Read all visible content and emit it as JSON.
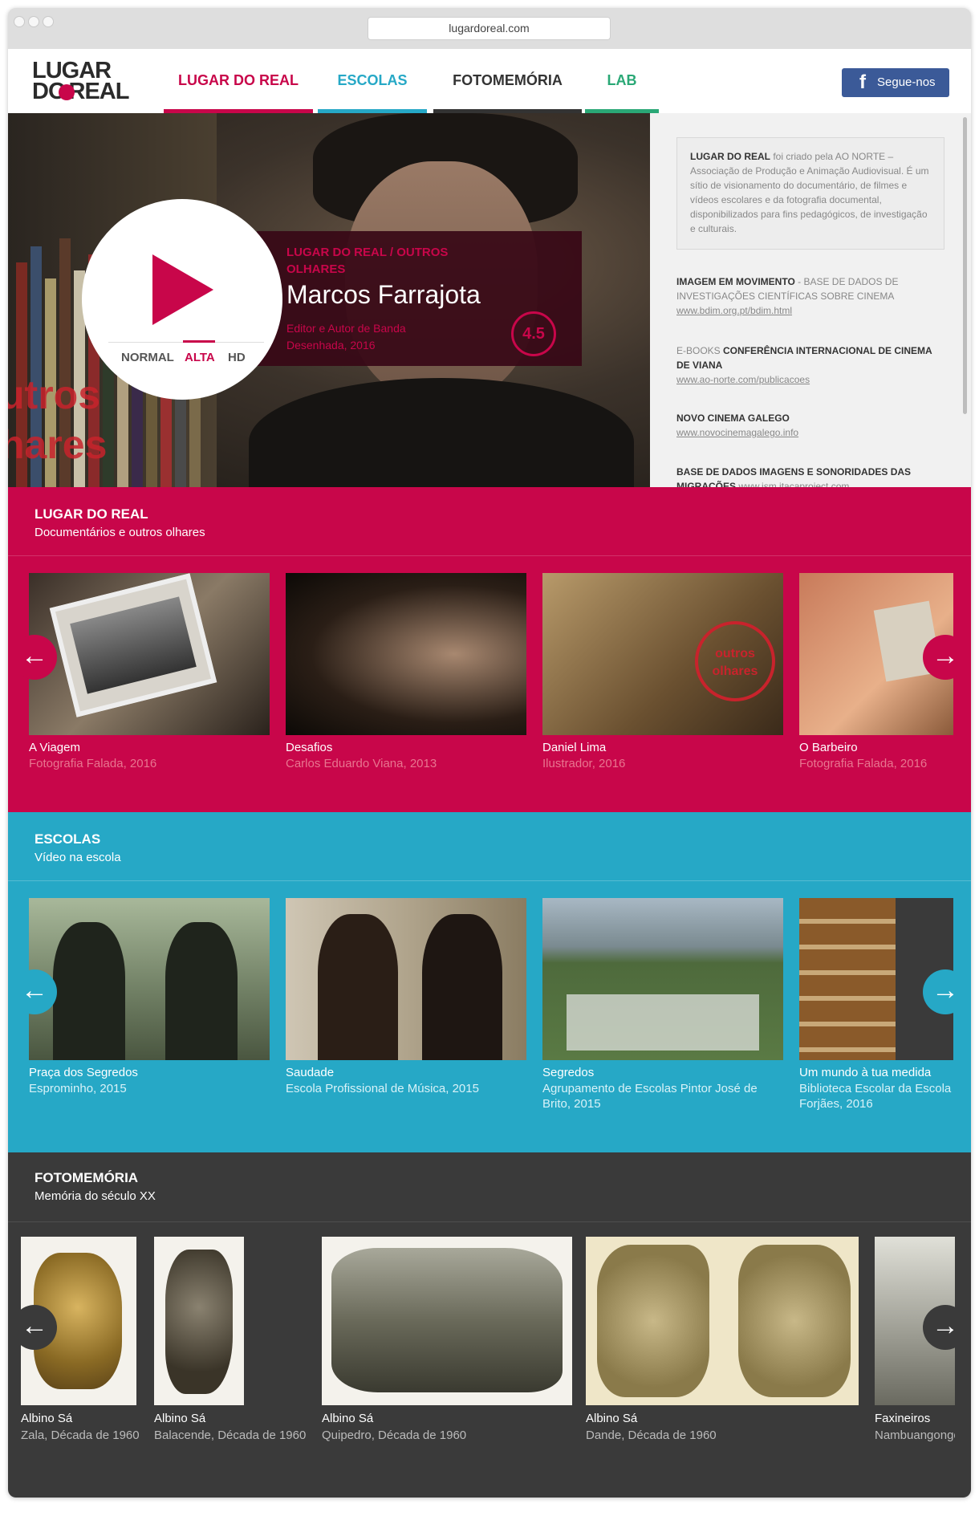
{
  "browser": {
    "url": "lugardoreal.com"
  },
  "logo": {
    "line1": "LUGAR",
    "line2_a": "DO",
    "line2_b": "REAL"
  },
  "nav": [
    {
      "label": "LUGAR DO REAL",
      "color": "#c8064a"
    },
    {
      "label": "ESCOLAS",
      "color": "#26a8c6"
    },
    {
      "label": "FOTOMEMÓRIA",
      "color": "#333333"
    },
    {
      "label": "LAB",
      "color": "#2aa876"
    }
  ],
  "social": {
    "icon": "facebook-icon",
    "label": "Segue-nos"
  },
  "hero": {
    "category": "LUGAR DO REAL / OUTROS OLHARES",
    "title": "Marcos Farrajota",
    "role": "Editor e Autor de Banda Desenhada, 2016",
    "rating": "4.5",
    "quality": [
      "NORMAL",
      "ALTA",
      "HD"
    ],
    "quality_selected": "ALTA",
    "stamp": "outros olhares"
  },
  "aside": {
    "intro_bold": "LUGAR DO REAL",
    "intro_text": " foi criado pela AO NORTE – Associação de Produção e Animação Audiovisual. É um sítio de visionamento do documentário, de filmes e vídeos escolares e da fotografia documental, disponibilizados para fins pedagógicos, de investigação e culturais.",
    "links": [
      {
        "bold": "IMAGEM EM MOVIMENTO",
        "text": " - BASE DE DADOS DE INVESTIGAÇÕES CIENTÍFICAS SOBRE CINEMA",
        "url": "www.bdim.org.pt/bdim.html"
      },
      {
        "pre": "E-BOOKS ",
        "bold": "CONFERÊNCIA INTERNACIONAL DE CINEMA DE VIANA",
        "text": "",
        "url": "www.ao-norte.com/publicacoes"
      },
      {
        "bold": "NOVO CINEMA GALEGO",
        "text": "",
        "url": "www.novocinemagalego.info"
      },
      {
        "bold": "BASE DE DADOS IMAGENS E SONORIDADES DAS MIGRAÇÕES",
        "text": "",
        "url": "www.ism.itacaproject.com"
      }
    ]
  },
  "sections": {
    "lugar": {
      "title": "LUGAR DO REAL",
      "subtitle": "Documentários e outros olhares",
      "color": "#c8064a",
      "items": [
        {
          "title": "A Viagem",
          "sub": "Fotografia Falada, 2016"
        },
        {
          "title": "Desafios",
          "sub": "Carlos Eduardo Viana, 2013"
        },
        {
          "title": "Daniel Lima",
          "sub": "Ilustrador, 2016"
        },
        {
          "title": "O Barbeiro",
          "sub": "Fotografia Falada, 2016"
        }
      ]
    },
    "escolas": {
      "title": "ESCOLAS",
      "subtitle": "Vídeo na escola",
      "color": "#26a8c6",
      "items": [
        {
          "title": "Praça dos Segredos",
          "sub": "Esprominho, 2015"
        },
        {
          "title": "Saudade",
          "sub": "Escola Profissional de Música, 2015"
        },
        {
          "title": "Segredos",
          "sub": "Agrupamento de Escolas Pintor José de Brito, 2015"
        },
        {
          "title": "Um mundo à tua medida",
          "sub": "Biblioteca Escolar da Escola Forjães, 2016"
        }
      ]
    },
    "foto": {
      "title": "FOTOMEMÓRIA",
      "subtitle": "Memória do século XX",
      "color": "#3a3a3a",
      "items": [
        {
          "title": "Albino Sá",
          "sub": "Zala, Década de 1960"
        },
        {
          "title": "Albino Sá",
          "sub": "Balacende, Década de 1960"
        },
        {
          "title": "Albino Sá",
          "sub": "Quipedro, Década de 1960"
        },
        {
          "title": "Albino Sá",
          "sub": "Dande, Década de 1960"
        },
        {
          "title": "Faxineiros",
          "sub": "Nambuangongo"
        }
      ]
    }
  }
}
